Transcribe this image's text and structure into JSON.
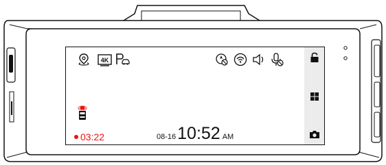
{
  "status_bar": {
    "left_icons": [
      "gps-icon",
      "4k-icon",
      "parking-icon"
    ],
    "resolution_label": "4K",
    "right_icons": [
      "location-off-icon",
      "wifi-icon",
      "speaker-icon",
      "microphone-off-icon"
    ]
  },
  "recording": {
    "time": "03:22",
    "status_color": "#ee1111"
  },
  "clock": {
    "date": "08-16",
    "time": "10:52",
    "period": "AM"
  },
  "side_panel": {
    "icons": [
      "lock-icon",
      "grid-menu-icon",
      "camera-icon"
    ]
  },
  "indicator": {
    "icon": "car-alert-icon"
  }
}
